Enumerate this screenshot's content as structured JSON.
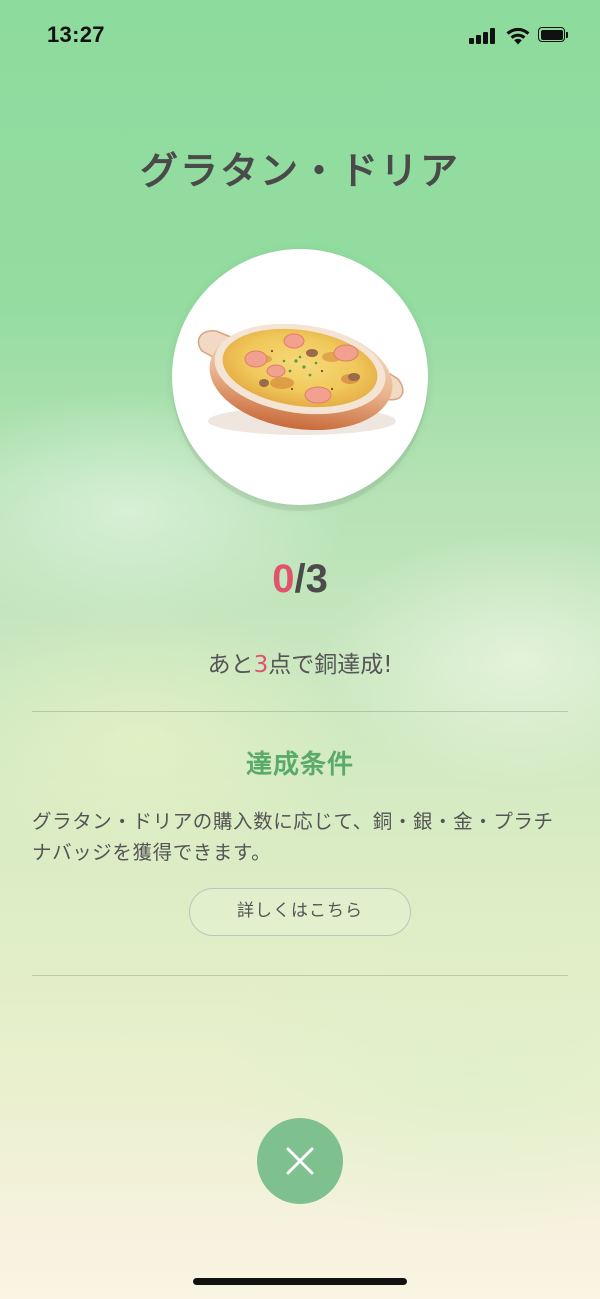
{
  "status_bar": {
    "time": "13:27",
    "icons": [
      "signal-icon",
      "wifi-icon",
      "battery-icon"
    ]
  },
  "badge": {
    "title": "グラタン・ドリア",
    "image_icon": "gratin-dish-icon",
    "progress": {
      "current": "0",
      "separator": "/",
      "total": "3"
    },
    "remaining": {
      "prefix": "あと",
      "points": "3",
      "suffix": "点で銅達成!"
    }
  },
  "conditions": {
    "heading": "達成条件",
    "description": "グラタン・ドリアの購入数に応じて、銅・銀・金・プラチナバッジを獲得できます。",
    "detail_button_label": "詳しくはこちら"
  },
  "close_button": {
    "icon": "close-icon"
  },
  "colors": {
    "accent_red": "#e0536b",
    "accent_green": "#5aaa6a",
    "close_button_bg": "#7ec08e"
  }
}
